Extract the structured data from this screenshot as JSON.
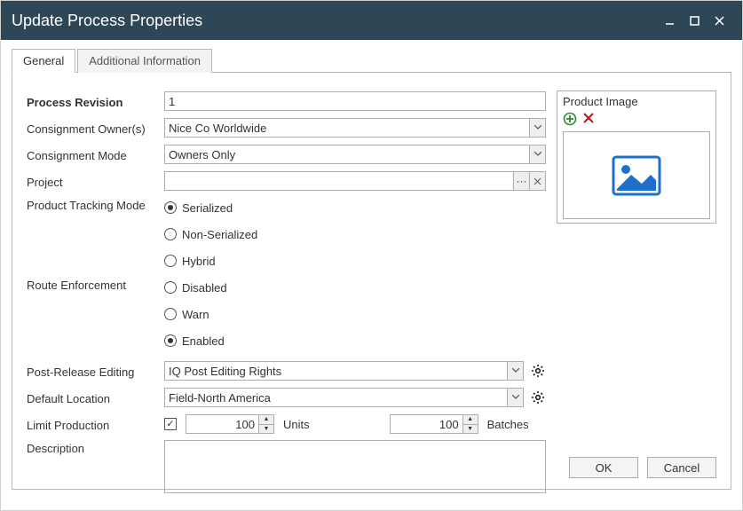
{
  "window": {
    "title": "Update Process Properties"
  },
  "tabs": {
    "general": "General",
    "additional": "Additional Information"
  },
  "labels": {
    "process_revision": "Process Revision",
    "consignment_owners": "Consignment Owner(s)",
    "consignment_mode": "Consignment Mode",
    "project": "Project",
    "product_tracking_mode": "Product Tracking Mode",
    "route_enforcement": "Route Enforcement",
    "post_release_editing": "Post-Release Editing",
    "default_location": "Default Location",
    "limit_production": "Limit Production",
    "description": "Description",
    "product_image": "Product Image",
    "units": "Units",
    "batches": "Batches"
  },
  "values": {
    "process_revision": "1",
    "consignment_owners": "Nice Co Worldwide",
    "consignment_mode": "Owners Only",
    "project": "",
    "post_release_editing": "IQ Post Editing Rights",
    "default_location": "Field-North America",
    "limit_units": "100",
    "limit_batches": "100",
    "limit_checked": true
  },
  "tracking_options": {
    "serialized": "Serialized",
    "non_serialized": "Non-Serialized",
    "hybrid": "Hybrid",
    "selected": "serialized"
  },
  "route_options": {
    "disabled": "Disabled",
    "warn": "Warn",
    "enabled": "Enabled",
    "selected": "enabled"
  },
  "buttons": {
    "ok": "OK",
    "cancel": "Cancel"
  }
}
